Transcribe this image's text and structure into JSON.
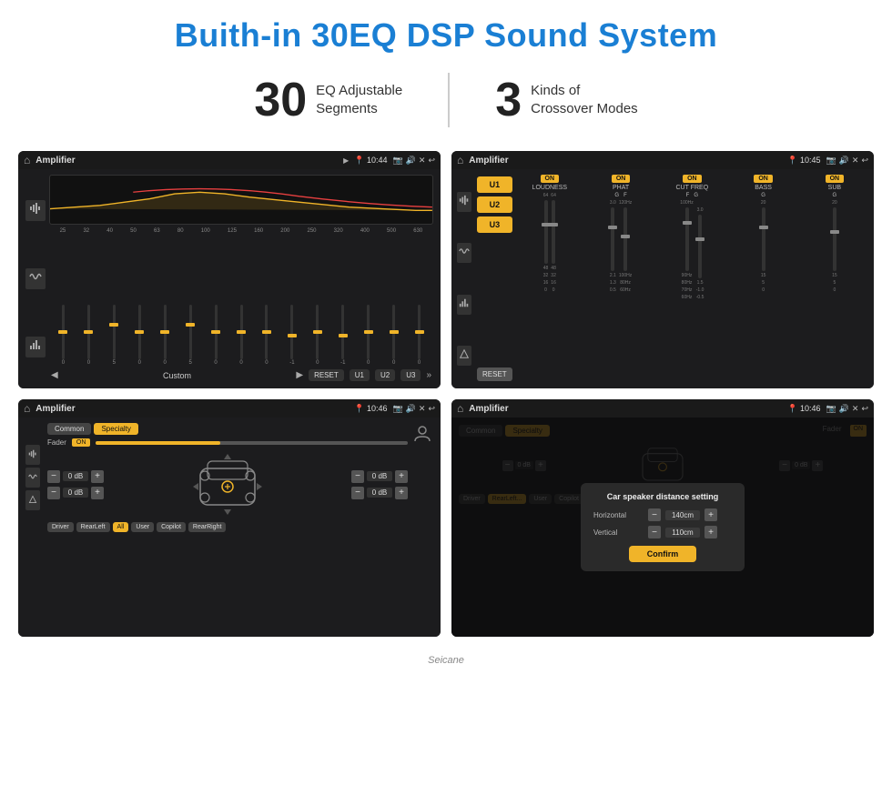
{
  "header": {
    "title": "Buith-in 30EQ DSP Sound System"
  },
  "stats": [
    {
      "number": "30",
      "text": "EQ Adjustable\nSegments"
    },
    {
      "number": "3",
      "text": "Kinds of\nCrossover Modes"
    }
  ],
  "screens": [
    {
      "id": "eq-custom",
      "topbar": {
        "home": "⌂",
        "title": "Amplifier",
        "time": "10:44"
      },
      "type": "eq",
      "freqs": [
        "25",
        "32",
        "40",
        "50",
        "63",
        "80",
        "100",
        "125",
        "160",
        "200",
        "250",
        "320",
        "400",
        "500",
        "630"
      ],
      "sliders": [
        0,
        0,
        5,
        0,
        0,
        5,
        0,
        0,
        0,
        -1,
        0,
        -1,
        0,
        0,
        0
      ],
      "bottomBtns": [
        "RESET",
        "U1",
        "U2",
        "U3"
      ],
      "modeLabel": "Custom"
    },
    {
      "id": "crossover",
      "topbar": {
        "home": "⌂",
        "title": "Amplifier",
        "time": "10:45"
      },
      "type": "crossover",
      "uBtns": [
        "U1",
        "U2",
        "U3"
      ],
      "modules": [
        {
          "label": "LOUDNESS",
          "on": true
        },
        {
          "label": "PHAT",
          "on": true
        },
        {
          "label": "CUT FREQ",
          "on": true
        },
        {
          "label": "BASS",
          "on": true
        },
        {
          "label": "SUB",
          "on": true
        }
      ]
    },
    {
      "id": "speaker-specialty",
      "topbar": {
        "home": "⌂",
        "title": "Amplifier",
        "time": "10:46"
      },
      "type": "speaker",
      "tabs": [
        "Common",
        "Specialty"
      ],
      "activeTab": 1,
      "fader": {
        "label": "Fader",
        "on": true
      },
      "channels": [
        {
          "label": "0 dB"
        },
        {
          "label": "0 dB"
        },
        {
          "label": "0 dB"
        },
        {
          "label": "0 dB"
        }
      ],
      "btns": [
        "Driver",
        "RearLeft",
        "All",
        "User",
        "Copilot",
        "RearRight"
      ],
      "allActive": true
    },
    {
      "id": "speaker-dialog",
      "topbar": {
        "home": "⌂",
        "title": "Amplifier",
        "time": "10:46"
      },
      "type": "speaker-dialog",
      "tabs": [
        "Common",
        "Specialty"
      ],
      "activeTab": 1,
      "dialog": {
        "title": "Car speaker distance setting",
        "rows": [
          {
            "label": "Horizontal",
            "value": "140cm"
          },
          {
            "label": "Vertical",
            "value": "110cm"
          }
        ],
        "confirmLabel": "Confirm"
      },
      "btns": [
        "Driver",
        "RearLeft",
        "User",
        "Copilot",
        "RearRight"
      ]
    }
  ],
  "watermark": "Seicane"
}
